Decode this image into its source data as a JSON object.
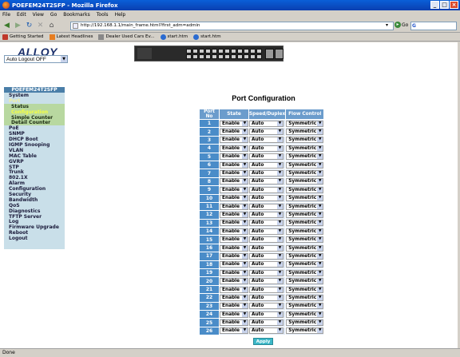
{
  "window": {
    "title": "POEFEM24T2SFP - Mozilla Firefox"
  },
  "menu": [
    "File",
    "Edit",
    "View",
    "Go",
    "Bookmarks",
    "Tools",
    "Help"
  ],
  "nav": {
    "url": "http://192.168.1.1/main_frame.html?first_adm=admin",
    "go_label": "Go"
  },
  "bookmarks": [
    {
      "label": "Getting Started",
      "icon": "getting-started-icon"
    },
    {
      "label": "Latest Headlines",
      "icon": "rss-icon"
    },
    {
      "label": "Dealer Used Cars Ev...",
      "icon": "page-icon"
    },
    {
      "label": "start.htm",
      "icon": "globe-icon"
    },
    {
      "label": "start.htm",
      "icon": "globe-icon"
    }
  ],
  "header": {
    "logo_text": "ALLOY",
    "auto_logout_value": "Auto Logout OFF"
  },
  "sidebar": {
    "title": "POEFEM24T2SFP",
    "items": [
      {
        "label": "System",
        "type": "top"
      },
      {
        "label": "Port",
        "type": "active"
      },
      {
        "label": "Status",
        "type": "sub"
      },
      {
        "label": "Configuration",
        "type": "sub-current"
      },
      {
        "label": "Simple Counter",
        "type": "sub"
      },
      {
        "label": "Detail Counter",
        "type": "sub"
      },
      {
        "label": "PoE",
        "type": "top"
      },
      {
        "label": "SNMP",
        "type": "top"
      },
      {
        "label": "DHCP Boot",
        "type": "top"
      },
      {
        "label": "IGMP Snooping",
        "type": "top"
      },
      {
        "label": "VLAN",
        "type": "top"
      },
      {
        "label": "MAC Table",
        "type": "top"
      },
      {
        "label": "GVRP",
        "type": "top"
      },
      {
        "label": "STP",
        "type": "top"
      },
      {
        "label": "Trunk",
        "type": "top"
      },
      {
        "label": "802.1X",
        "type": "top"
      },
      {
        "label": "Alarm",
        "type": "top"
      },
      {
        "label": "Configuration",
        "type": "top"
      },
      {
        "label": "Security",
        "type": "top"
      },
      {
        "label": "Bandwidth",
        "type": "top"
      },
      {
        "label": "QoS",
        "type": "top"
      },
      {
        "label": "Diagnostics",
        "type": "top"
      },
      {
        "label": "TFTP Server",
        "type": "top"
      },
      {
        "label": "Log",
        "type": "top"
      },
      {
        "label": "Firmware Upgrade",
        "type": "top"
      },
      {
        "label": "Reboot",
        "type": "top"
      },
      {
        "label": "Logout",
        "type": "top"
      }
    ]
  },
  "main": {
    "title": "Port Configuration",
    "columns": [
      "Port No",
      "State",
      "Speed/Duplex",
      "Flow Control"
    ],
    "rows": [
      {
        "port": "1",
        "state": "Enable",
        "speed": "Auto",
        "flow": "Symmetric"
      },
      {
        "port": "2",
        "state": "Enable",
        "speed": "Auto",
        "flow": "Symmetric"
      },
      {
        "port": "3",
        "state": "Enable",
        "speed": "Auto",
        "flow": "Symmetric"
      },
      {
        "port": "4",
        "state": "Enable",
        "speed": "Auto",
        "flow": "Symmetric"
      },
      {
        "port": "5",
        "state": "Enable",
        "speed": "Auto",
        "flow": "Symmetric"
      },
      {
        "port": "6",
        "state": "Enable",
        "speed": "Auto",
        "flow": "Symmetric"
      },
      {
        "port": "7",
        "state": "Enable",
        "speed": "Auto",
        "flow": "Symmetric"
      },
      {
        "port": "8",
        "state": "Enable",
        "speed": "Auto",
        "flow": "Symmetric"
      },
      {
        "port": "9",
        "state": "Enable",
        "speed": "Auto",
        "flow": "Symmetric"
      },
      {
        "port": "10",
        "state": "Enable",
        "speed": "Auto",
        "flow": "Symmetric"
      },
      {
        "port": "11",
        "state": "Enable",
        "speed": "Auto",
        "flow": "Symmetric"
      },
      {
        "port": "12",
        "state": "Enable",
        "speed": "Auto",
        "flow": "Symmetric"
      },
      {
        "port": "13",
        "state": "Enable",
        "speed": "Auto",
        "flow": "Symmetric"
      },
      {
        "port": "14",
        "state": "Enable",
        "speed": "Auto",
        "flow": "Symmetric"
      },
      {
        "port": "15",
        "state": "Enable",
        "speed": "Auto",
        "flow": "Symmetric"
      },
      {
        "port": "16",
        "state": "Enable",
        "speed": "Auto",
        "flow": "Symmetric"
      },
      {
        "port": "17",
        "state": "Enable",
        "speed": "Auto",
        "flow": "Symmetric"
      },
      {
        "port": "18",
        "state": "Enable",
        "speed": "Auto",
        "flow": "Symmetric"
      },
      {
        "port": "19",
        "state": "Enable",
        "speed": "Auto",
        "flow": "Symmetric"
      },
      {
        "port": "20",
        "state": "Enable",
        "speed": "Auto",
        "flow": "Symmetric"
      },
      {
        "port": "21",
        "state": "Enable",
        "speed": "Auto",
        "flow": "Symmetric"
      },
      {
        "port": "22",
        "state": "Enable",
        "speed": "Auto",
        "flow": "Symmetric"
      },
      {
        "port": "23",
        "state": "Enable",
        "speed": "Auto",
        "flow": "Symmetric"
      },
      {
        "port": "24",
        "state": "Enable",
        "speed": "Auto",
        "flow": "Symmetric"
      },
      {
        "port": "25",
        "state": "Enable",
        "speed": "Auto",
        "flow": "Symmetric"
      },
      {
        "port": "26",
        "state": "Enable",
        "speed": "Auto",
        "flow": "Symmetric"
      }
    ],
    "apply_label": "Apply"
  },
  "status": {
    "text": "Done"
  }
}
